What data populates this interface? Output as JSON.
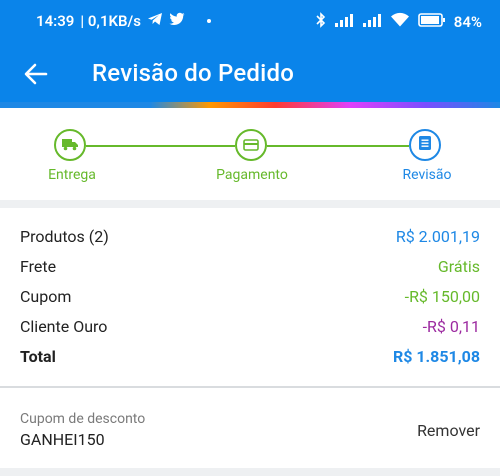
{
  "status_bar": {
    "time": "14:39",
    "network_speed": "| 0,1KB/s",
    "battery": "84%"
  },
  "app_bar": {
    "title": "Revisão do Pedido"
  },
  "stepper": {
    "steps": [
      {
        "label": "Entrega",
        "state": "done",
        "icon": "truck-icon"
      },
      {
        "label": "Pagamento",
        "state": "done",
        "icon": "card-icon"
      },
      {
        "label": "Revisão",
        "state": "current",
        "icon": "list-icon"
      }
    ]
  },
  "summary": {
    "rows": [
      {
        "label": "Produtos (2)",
        "value": "R$ 2.001,19",
        "color": "#1e88e5"
      },
      {
        "label": "Frete",
        "value": "Grátis",
        "color": "#66b92b"
      },
      {
        "label": "Cupom",
        "value": "-R$ 150,00",
        "color": "#66b92b"
      },
      {
        "label": "Cliente Ouro",
        "value": "-R$ 0,11",
        "color": "#9c2aa0"
      },
      {
        "label": "Total",
        "value": "R$ 1.851,08",
        "color": "#1e88e5"
      }
    ]
  },
  "coupon": {
    "label": "Cupom de desconto",
    "code": "GANHEI150",
    "remove_label": "Remover"
  },
  "colors": {
    "primary": "#0a84ea",
    "green": "#66b92b",
    "blue": "#1e88e5",
    "purple": "#9c2aa0"
  }
}
